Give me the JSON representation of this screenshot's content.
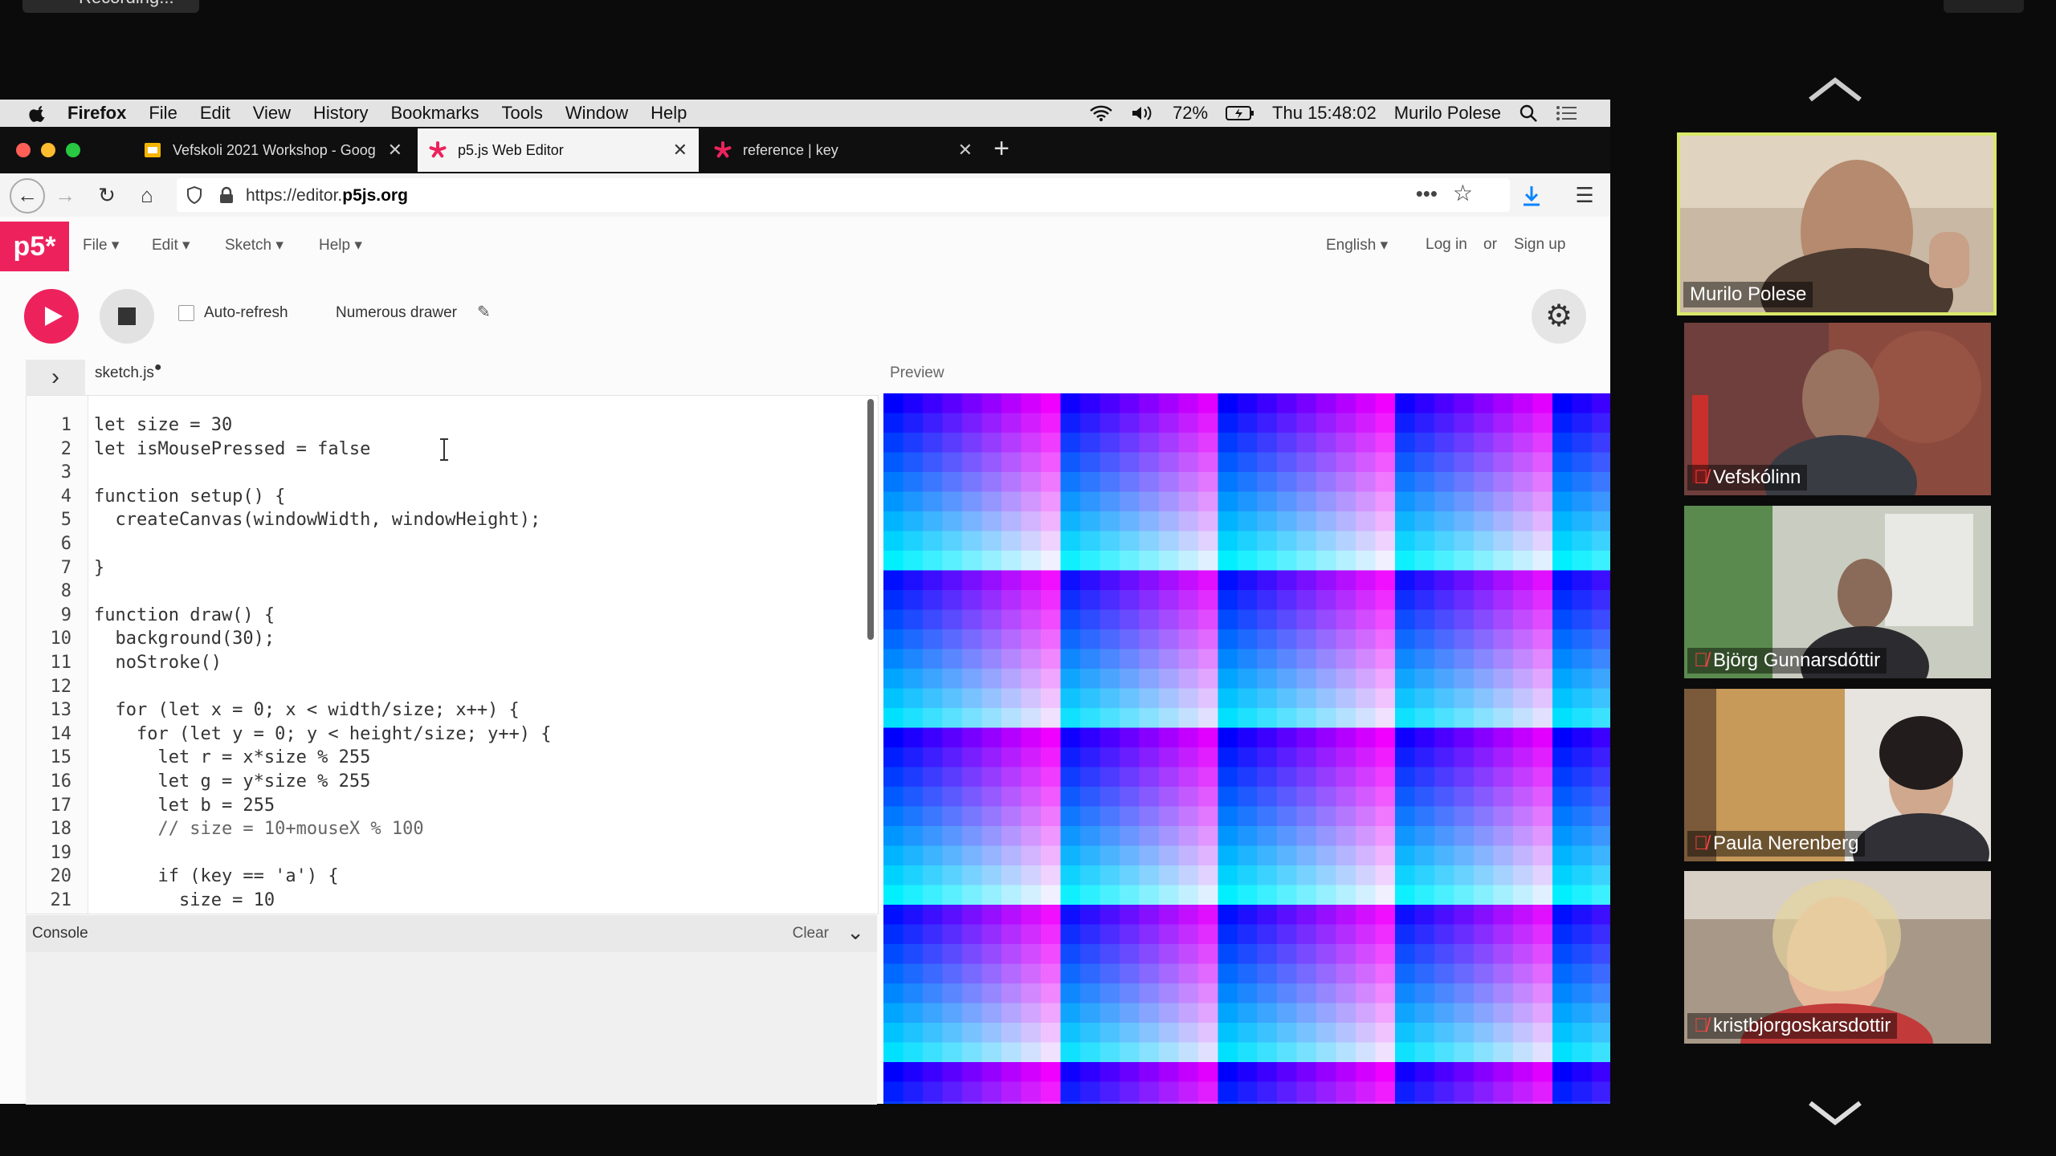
{
  "recording": {
    "label": "Recording..."
  },
  "menubar": {
    "items": [
      "Firefox",
      "File",
      "Edit",
      "View",
      "History",
      "Bookmarks",
      "Tools",
      "Window",
      "Help"
    ],
    "battery": "72%",
    "clock": "Thu 15:48:02",
    "user": "Murilo Polese"
  },
  "tabs": [
    {
      "label": "Vefskoli 2021 Workshop - Goog",
      "favicon": "slides-icon"
    },
    {
      "label": "p5.js Web Editor",
      "favicon": "p5-asterisk-icon"
    },
    {
      "label": "reference | key",
      "favicon": "p5-asterisk-icon"
    }
  ],
  "url": {
    "prefix": "https://editor.",
    "domain": "p5js.org"
  },
  "p5": {
    "logo": "p5*",
    "menu": [
      "File",
      "Edit",
      "Sketch",
      "Help"
    ],
    "language": "English",
    "login": "Log in",
    "or": "or",
    "signup": "Sign up",
    "autorefresh": "Auto-refresh",
    "sketch_name": "Numerous drawer",
    "file_tab": "sketch.js",
    "preview_label": "Preview",
    "console_label": "Console",
    "clear_label": "Clear"
  },
  "code_lines": [
    "let size = 30",
    "let isMousePressed = false",
    "",
    "function setup() {",
    "  createCanvas(windowWidth, windowHeight);",
    "",
    "}",
    "",
    "function draw() {",
    "  background(30);",
    "  noStroke()",
    "",
    "  for (let x = 0; x < width/size; x++) {",
    "    for (let y = 0; y < height/size; y++) {",
    "      let r = x*size % 255",
    "      let g = y*size % 255",
    "      let b = 255",
    "      // size = 10+mouseX % 100",
    "",
    "      if (key == 'a') {",
    "        size = 10"
  ],
  "participants": [
    {
      "name": "Murilo Polese",
      "muted": false,
      "active": true
    },
    {
      "name": "Vefskólinn",
      "muted": true,
      "active": false
    },
    {
      "name": "Björg Gunnarsdóttir",
      "muted": true,
      "active": false
    },
    {
      "name": "Paula Nerenberg",
      "muted": true,
      "active": false
    },
    {
      "name": "kristbjorgoskarsdottir",
      "muted": true,
      "active": false
    }
  ],
  "colors": {
    "p5_pink": "#ed225d",
    "speaker_border": "#d8e86a"
  }
}
